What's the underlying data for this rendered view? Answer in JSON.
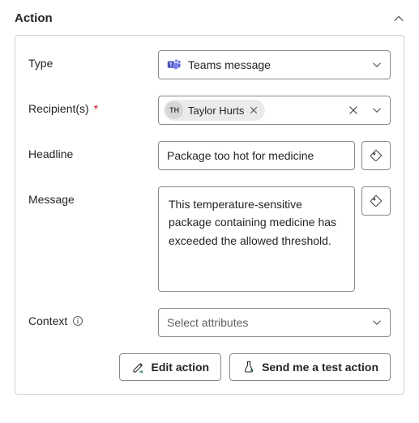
{
  "header": {
    "title": "Action"
  },
  "fields": {
    "type": {
      "label": "Type",
      "value": "Teams message",
      "icon": "teams-icon"
    },
    "recipients": {
      "label": "Recipient(s)",
      "required": "*",
      "chip": {
        "initials": "TH",
        "name": "Taylor Hurts"
      }
    },
    "headline": {
      "label": "Headline",
      "value": "Package too hot for medicine"
    },
    "message": {
      "label": "Message",
      "value": "This temperature-sensitive package containing medicine has exceeded the allowed threshold."
    },
    "context": {
      "label": "Context",
      "placeholder": "Select attributes"
    }
  },
  "buttons": {
    "edit": "Edit action",
    "test": "Send me a test action"
  }
}
